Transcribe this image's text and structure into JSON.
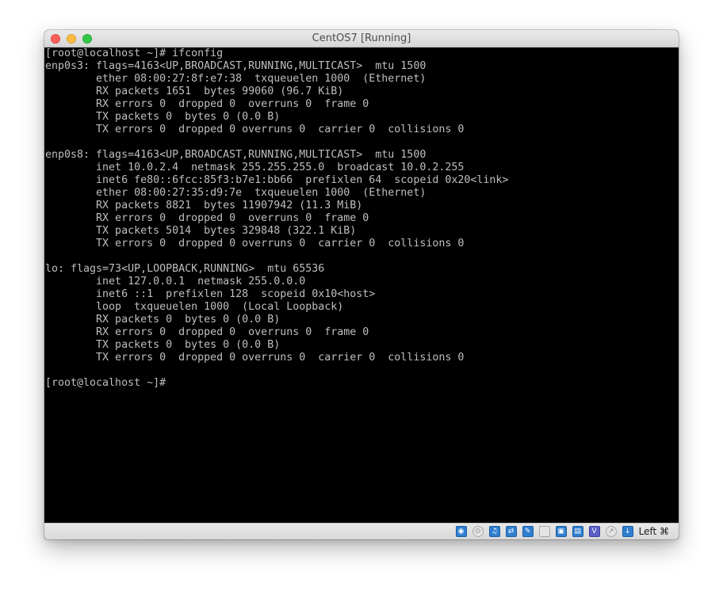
{
  "window": {
    "title": "CentOS7 [Running]"
  },
  "console": {
    "lines": [
      "[root@localhost ~]# ifconfig",
      "enp0s3: flags=4163<UP,BROADCAST,RUNNING,MULTICAST>  mtu 1500",
      "        ether 08:00:27:8f:e7:38  txqueuelen 1000  (Ethernet)",
      "        RX packets 1651  bytes 99060 (96.7 KiB)",
      "        RX errors 0  dropped 0  overruns 0  frame 0",
      "        TX packets 0  bytes 0 (0.0 B)",
      "        TX errors 0  dropped 0 overruns 0  carrier 0  collisions 0",
      "",
      "enp0s8: flags=4163<UP,BROADCAST,RUNNING,MULTICAST>  mtu 1500",
      "        inet 10.0.2.4  netmask 255.255.255.0  broadcast 10.0.2.255",
      "        inet6 fe80::6fcc:85f3:b7e1:bb66  prefixlen 64  scopeid 0x20<link>",
      "        ether 08:00:27:35:d9:7e  txqueuelen 1000  (Ethernet)",
      "        RX packets 8821  bytes 11907942 (11.3 MiB)",
      "        RX errors 0  dropped 0  overruns 0  frame 0",
      "        TX packets 5014  bytes 329848 (322.1 KiB)",
      "        TX errors 0  dropped 0 overruns 0  carrier 0  collisions 0",
      "",
      "lo: flags=73<UP,LOOPBACK,RUNNING>  mtu 65536",
      "        inet 127.0.0.1  netmask 255.0.0.0",
      "        inet6 ::1  prefixlen 128  scopeid 0x10<host>",
      "        loop  txqueuelen 1000  (Local Loopback)",
      "        RX packets 0  bytes 0 (0.0 B)",
      "        RX errors 0  dropped 0  overruns 0  frame 0",
      "        TX packets 0  bytes 0 (0.0 B)",
      "        TX errors 0  dropped 0 overruns 0  carrier 0  collisions 0",
      "",
      "[root@localhost ~]#"
    ]
  },
  "statusbar": {
    "icons": [
      {
        "name": "hard-disk-icon",
        "glyph": "◉",
        "style": "blue"
      },
      {
        "name": "optical-drive-icon",
        "glyph": "⊙",
        "style": "grey round"
      },
      {
        "name": "audio-icon",
        "glyph": "♫",
        "style": "blue"
      },
      {
        "name": "network-icon",
        "glyph": "⇄",
        "style": "blue"
      },
      {
        "name": "usb-icon",
        "glyph": "✎",
        "style": "blue"
      },
      {
        "name": "shared-folders-icon",
        "glyph": "",
        "style": "grey"
      },
      {
        "name": "display-icon",
        "glyph": "▣",
        "style": "blue"
      },
      {
        "name": "video-capture-icon",
        "glyph": "▤",
        "style": "blue"
      },
      {
        "name": "virtualization-icon",
        "glyph": "V",
        "style": "purple"
      },
      {
        "name": "mouse-integration-icon",
        "glyph": "↗",
        "style": "grey round"
      },
      {
        "name": "keyboard-capture-icon",
        "glyph": "↓",
        "style": "blue"
      }
    ],
    "host_key": "Left ⌘"
  }
}
